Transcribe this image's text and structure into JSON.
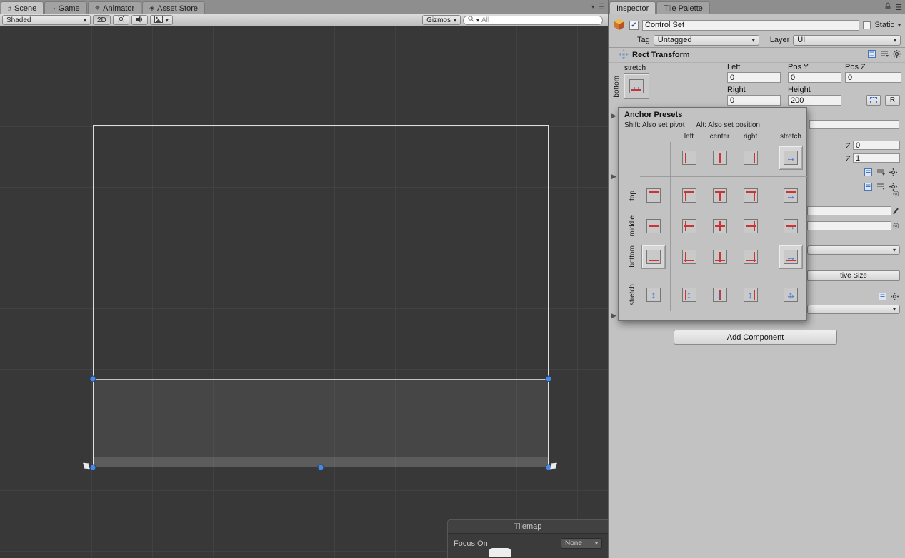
{
  "tabs_left": [
    {
      "label": "Scene"
    },
    {
      "label": "Game"
    },
    {
      "label": "Animator"
    },
    {
      "label": "Asset Store"
    }
  ],
  "tabs_right": [
    {
      "label": "Inspector"
    },
    {
      "label": "Tile Palette"
    }
  ],
  "scene_toolbar": {
    "shaded": "Shaded",
    "two_d": "2D",
    "gizmos": "Gizmos",
    "search": "All"
  },
  "tilemap": {
    "title": "Tilemap",
    "focus_label": "Focus On",
    "focus_value": "None"
  },
  "inspector": {
    "name_value": "Control Set",
    "static_label": "Static",
    "tag_label": "Tag",
    "tag_value": "Untagged",
    "layer_label": "Layer",
    "layer_value": "UI",
    "rect_transform": {
      "title": "Rect Transform",
      "anchor_h_label": "stretch",
      "anchor_v_label": "bottom",
      "f1_label": "Left",
      "f1_value": "0",
      "f2_label": "Pos Y",
      "f2_value": "0",
      "f3_label": "Pos Z",
      "f3_value": "0",
      "f4_label": "Right",
      "f4_value": "0",
      "f5_label": "Height",
      "f5_value": "200",
      "r_button": "R"
    },
    "partial": {
      "z_label": "Z",
      "rotation_z": "0",
      "scale_z": "1",
      "native_size_button": "tive Size"
    },
    "add_component_button": "Add Component"
  },
  "anchor_presets": {
    "title": "Anchor Presets",
    "shift_hint": "Shift: Also set pivot",
    "alt_hint": "Alt: Also set position",
    "cols": [
      "left",
      "center",
      "right",
      "stretch"
    ],
    "rows": [
      "top",
      "middle",
      "bottom",
      "stretch"
    ]
  },
  "colors": {
    "accent_blue": "#3a6fd0",
    "anchor_red": "#cc3333",
    "handle_blue": "#4f86d8",
    "scene_bg": "#383838",
    "panel_bg": "#c2c2c2"
  }
}
